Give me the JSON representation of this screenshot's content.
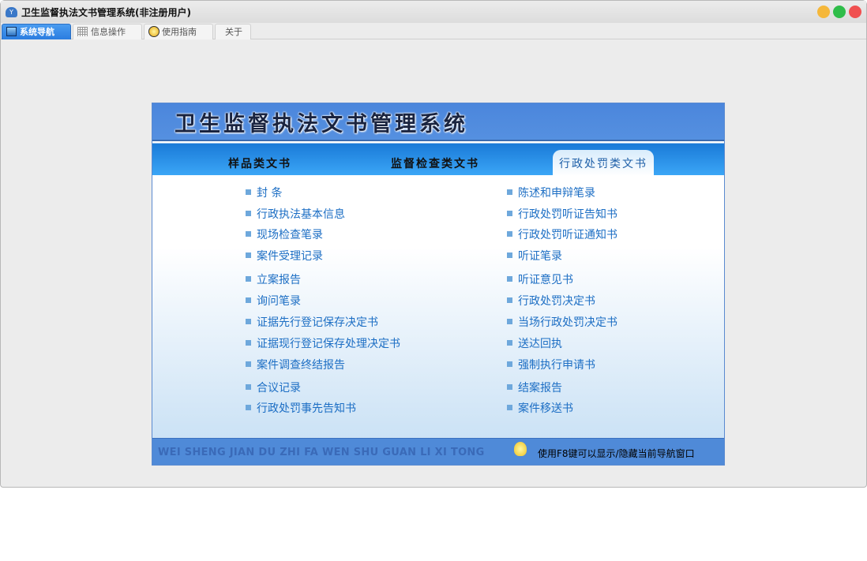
{
  "window": {
    "title": "卫生监督执法文书管理系统(非注册用户)",
    "app_icon": "cloud-app-icon",
    "controls": {
      "minimize": "#f5b73a",
      "maximize": "#2fbd4a",
      "close": "#f05050"
    }
  },
  "tabs": [
    {
      "label": "系统导航",
      "icon": "monitor-icon",
      "active": true
    },
    {
      "label": "信息操作",
      "icon": "grid-icon"
    },
    {
      "label": "使用指南",
      "icon": "help-icon"
    },
    {
      "label": "关于"
    }
  ],
  "panel": {
    "title": "卫生监督执法文书管理系统",
    "nav": [
      {
        "label": "样品类文书"
      },
      {
        "label": "监督检查类文书"
      },
      {
        "label": "行政处罚类文书",
        "active": true
      }
    ],
    "left_items": [
      "封  条",
      "行政执法基本信息",
      "现场检查笔录",
      "案件受理记录",
      "立案报告",
      "询问笔录",
      "证据先行登记保存决定书",
      "证据现行登记保存处理决定书",
      "案件调查终结报告",
      "合议记录",
      "行政处罚事先告知书"
    ],
    "right_items": [
      "陈述和申辩笔录",
      "行政处罚听证告知书",
      "行政处罚听证通知书",
      "听证笔录",
      "听证意见书",
      "行政处罚决定书",
      "当场行政处罚决定书",
      "送达回执",
      "强制执行申请书",
      "结案报告",
      "案件移送书"
    ],
    "footer": {
      "pinyin": "WEI SHENG JIAN DU ZHI FA WEN SHU GUAN LI XI TONG",
      "hint": "使用F8键可以显示/隐藏当前导航窗口"
    }
  }
}
